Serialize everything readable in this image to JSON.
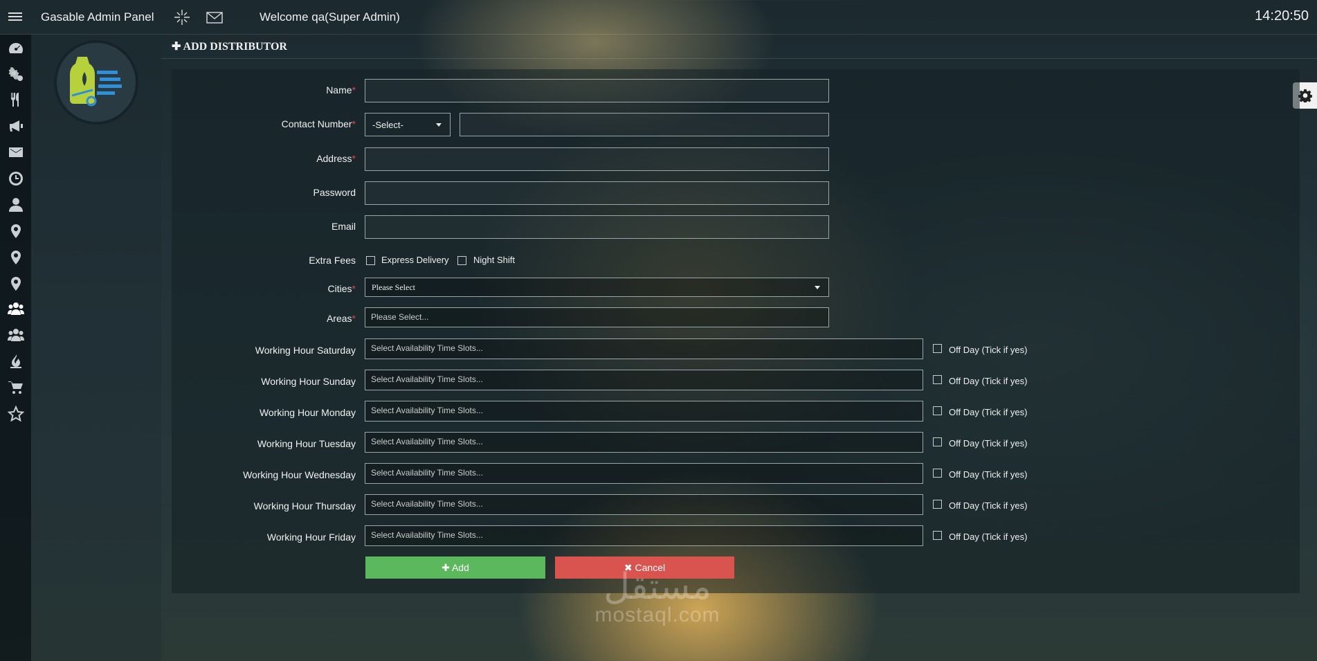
{
  "app": {
    "title": "Gasable Admin Panel",
    "welcome": "Welcome qa(Super Admin)",
    "clock": "14:20:50"
  },
  "header": {
    "icon": "plus-icon",
    "title": "ADD DISTRIBUTOR"
  },
  "sidebar": {
    "icons": [
      "dashboard-icon",
      "settings-icon",
      "restaurant-icon",
      "megaphone-icon",
      "envelope-icon",
      "clock-icon",
      "user-icon",
      "map-marker-icon",
      "map-marker-icon",
      "map-marker-icon",
      "users-icon",
      "users-icon",
      "flame-icon",
      "cart-icon",
      "star-icon"
    ],
    "active_index": 10
  },
  "form": {
    "name": {
      "label": "Name",
      "value": ""
    },
    "contact": {
      "label": "Contact Number",
      "code_select": "-Select-",
      "value": ""
    },
    "address": {
      "label": "Address",
      "value": ""
    },
    "password": {
      "label": "Password",
      "value": ""
    },
    "email": {
      "label": "Email",
      "value": ""
    },
    "extra_fees": {
      "label": "Extra Fees",
      "options": [
        "Express Delivery",
        "Night Shift"
      ]
    },
    "cities": {
      "label": "Cities",
      "selected": "Please Select"
    },
    "areas": {
      "label": "Areas",
      "placeholder": "Please Select..."
    },
    "working_hours": [
      {
        "label": "Working Hour Saturday",
        "placeholder": "Select Availability Time Slots...",
        "off_day": "Off Day (Tick if yes)"
      },
      {
        "label": "Working Hour Sunday",
        "placeholder": "Select Availability Time Slots...",
        "off_day": "Off Day (Tick if yes)"
      },
      {
        "label": "Working Hour Monday",
        "placeholder": "Select Availability Time Slots...",
        "off_day": "Off Day (Tick if yes)"
      },
      {
        "label": "Working Hour Tuesday",
        "placeholder": "Select Availability Time Slots...",
        "off_day": "Off Day (Tick if yes)"
      },
      {
        "label": "Working Hour Wednesday",
        "placeholder": "Select Availability Time Slots...",
        "off_day": "Off Day (Tick if yes)"
      },
      {
        "label": "Working Hour Thursday",
        "placeholder": "Select Availability Time Slots...",
        "off_day": "Off Day (Tick if yes)"
      },
      {
        "label": "Working Hour Friday",
        "placeholder": "Select Availability Time Slots...",
        "off_day": "Off Day (Tick if yes)"
      }
    ],
    "buttons": {
      "add": "Add",
      "cancel": "Cancel"
    }
  },
  "watermark": {
    "arabic": "مستقل",
    "latin": "mostaql.com"
  },
  "colors": {
    "add": "#5cb85c",
    "cancel": "#d9534f",
    "required": "#e04848"
  }
}
